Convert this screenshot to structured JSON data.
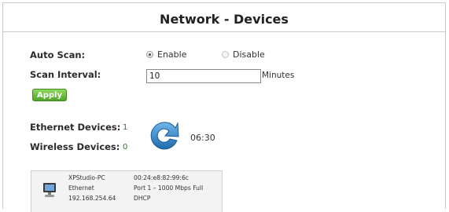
{
  "page": {
    "title": "Network - Devices"
  },
  "auto_scan": {
    "label": "Auto Scan:",
    "options": [
      {
        "label": "Enable",
        "selected": true
      },
      {
        "label": "Disable",
        "selected": false
      }
    ]
  },
  "scan_interval": {
    "label": "Scan Interval:",
    "value": "10",
    "unit": "Minutes"
  },
  "apply_button": {
    "label": "Apply",
    "color": "#5cb531"
  },
  "counts": {
    "ethernet_label": "Ethernet Devices:",
    "ethernet_value": "1",
    "wireless_label": "Wireless Devices:",
    "wireless_value": "0",
    "count_color": "#2a7a2a"
  },
  "refresh": {
    "icon": "refresh-icon",
    "color": "#2f7fbf",
    "timer": "06:30"
  },
  "devices": [
    {
      "icon": "computer-icon",
      "name": "XPStudio-PC",
      "type": "Ethernet",
      "ip": "192.168.254.64",
      "mac": "00:24:e8:82:99:6c",
      "port": "Port 1 – 1000 Mbps Full",
      "addressing": "DHCP"
    }
  ]
}
